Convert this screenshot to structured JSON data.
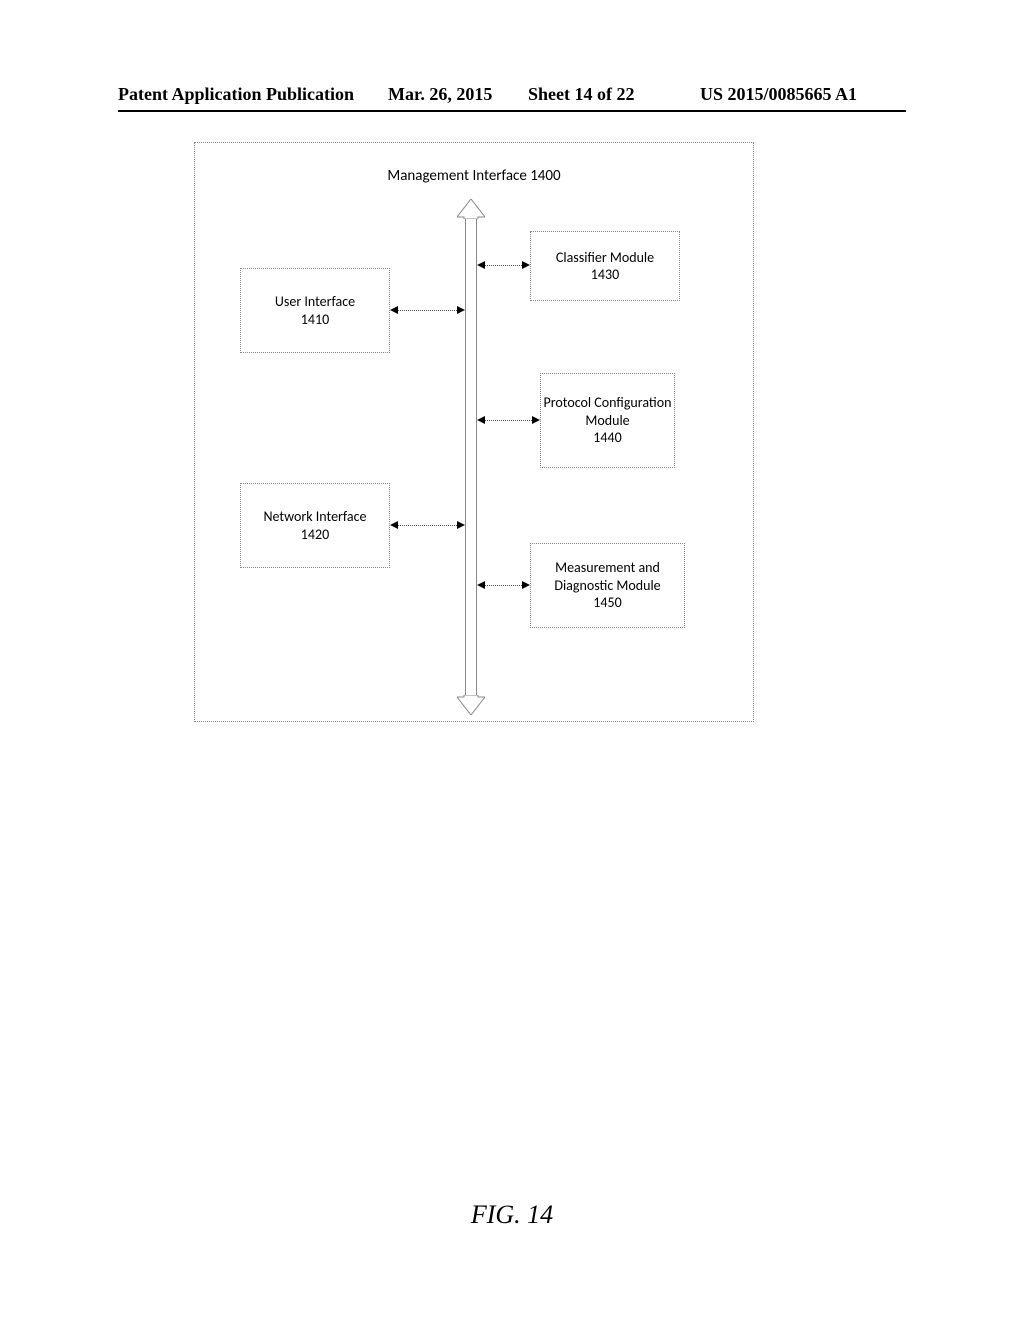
{
  "header": {
    "publication": "Patent Application Publication",
    "date": "Mar. 26, 2015",
    "sheet": "Sheet 14 of 22",
    "appno": "US 2015/0085665 A1"
  },
  "diagram": {
    "title": "Management Interface 1400",
    "modules": {
      "ui": {
        "name": "User  Interface",
        "num": "1410"
      },
      "net": {
        "name": "Network Interface",
        "num": "1420"
      },
      "cls": {
        "name": "Classifier Module",
        "num": "1430"
      },
      "proto": {
        "name": "Protocol Configuration Module",
        "num": "1440"
      },
      "meas": {
        "name": "Measurement and Diagnostic Module",
        "num": "1450"
      }
    }
  },
  "figure_caption": "FIG. 14"
}
